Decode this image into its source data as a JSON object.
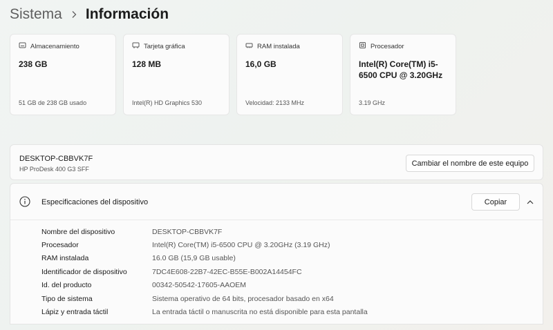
{
  "breadcrumb": {
    "parent": "Sistema",
    "current": "Información"
  },
  "cards": [
    {
      "icon": "storage-icon",
      "title": "Almacenamiento",
      "value": "238 GB",
      "sub": "51 GB de 238 GB usado"
    },
    {
      "icon": "graphics-card-icon",
      "title": "Tarjeta gráfica",
      "value": "128 MB",
      "sub": "Intel(R) HD Graphics 530"
    },
    {
      "icon": "ram-icon",
      "title": "RAM instalada",
      "value": "16,0 GB",
      "sub": "Velocidad: 2133 MHz"
    },
    {
      "icon": "processor-icon",
      "title": "Procesador",
      "value": "Intel(R) Core(TM) i5-6500 CPU @ 3.20GHz",
      "sub": "3.19 GHz"
    }
  ],
  "device": {
    "name": "DESKTOP-CBBVK7F",
    "model": "HP ProDesk 400 G3 SFF",
    "rename_label": "Cambiar el nombre de este equipo"
  },
  "specs": {
    "title": "Especificaciones del dispositivo",
    "copy_label": "Copiar",
    "rows": [
      {
        "label": "Nombre del dispositivo",
        "value": "DESKTOP-CBBVK7F"
      },
      {
        "label": "Procesador",
        "value": "Intel(R) Core(TM) i5-6500 CPU @ 3.20GHz (3.19 GHz)"
      },
      {
        "label": "RAM instalada",
        "value": "16.0 GB (15,9 GB usable)"
      },
      {
        "label": "Identificador de dispositivo",
        "value": "7DC4E608-22B7-42EC-B55E-B002A14454FC"
      },
      {
        "label": "Id. del producto",
        "value": "00342-50542-17605-AAOEM"
      },
      {
        "label": "Tipo de sistema",
        "value": "Sistema operativo de 64 bits, procesador basado en x64"
      },
      {
        "label": "Lápiz y entrada táctil",
        "value": "La entrada táctil o manuscrita no está disponible para esta pantalla"
      }
    ]
  }
}
